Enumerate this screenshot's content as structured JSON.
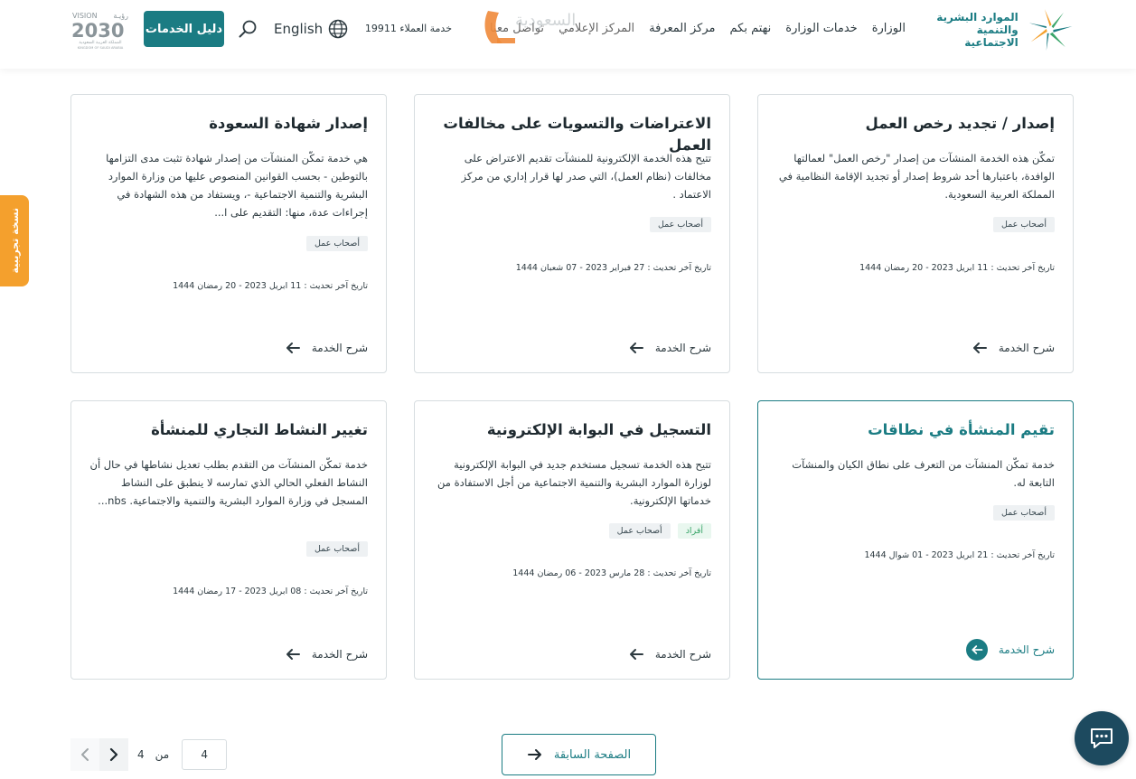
{
  "header": {
    "logo_line1": "الموارد البشرية",
    "logo_line2": "والتنمية الاجتماعية",
    "nav": [
      "الوزارة",
      "خدمات الوزارة",
      "نهتم بكم",
      "مركز المعرفة",
      "المركز الإعلامي",
      "تواصل معنا"
    ],
    "hotline": "خدمة العملاء 19911",
    "language": "English",
    "guide_button": "دليل الخدمات",
    "watermark_text": "السعودية",
    "vision_text": "VISION",
    "vision_year": "2030",
    "vision_ar": "رؤيـة",
    "vision_sub": "المملكة العربية السعودية",
    "vision_sub_en": "KINGDOM OF SAUDI ARABIA",
    "colors": {
      "primary": "#1b7c83",
      "accent": "#f4a02d",
      "chat": "#1d4a5f"
    }
  },
  "side_tab": "نسخة تجريبية",
  "cards": [
    {
      "title": "إصدار / تجديد رخص العمل",
      "description": "تمكّن هذه الخدمة المنشآت من إصدار \"رخص العمل\" لعمالتها الوافدة، باعتبارها أحد شروط إصدار أو تجديد الإقامة النظامية في المملكة العربية السعودية.",
      "tags": [
        {
          "label": "أصحاب عمل",
          "style": "gray"
        }
      ],
      "date": "تاريخ آخر تحديث : 11 ابريل 2023 - 20 رمضان 1444",
      "link": "شرح الخدمة"
    },
    {
      "title": "الاعتراضات والتسويات على مخالفات العمل",
      "description": "تتيح هذه الخدمة الإلكترونية للمنشآت تقديم الاعتراض على مخالفات (نظام العمل)، التي صدر لها قرار إداري من مركز الاعتماد .",
      "tags": [
        {
          "label": "أصحاب عمل",
          "style": "gray"
        }
      ],
      "date": "تاريخ آخر تحديث : 27 فبراير 2023 - 07 شعبان 1444",
      "link": "شرح الخدمة"
    },
    {
      "title": "إصدار شهادة السعودة",
      "description": "هي خدمة تمكّن المنشآت من إصدار شهادة تثبت مدى التزامها بالتوطين - بحسب القوانين المنصوص عليها من وزارة الموارد البشرية والتنمية الاجتماعية -، ويستفاد من هذه الشهادة في إجراءات عدة، منها: التقديم على ا...",
      "tags": [
        {
          "label": "أصحاب عمل",
          "style": "gray"
        }
      ],
      "date": "تاريخ آخر تحديث : 11 ابريل 2023 - 20 رمضان 1444",
      "link": "شرح الخدمة"
    },
    {
      "title": "تقيم المنشأة في نطاقات",
      "description": "خدمة تمكّن المنشآت من التعرف على نطاق الكيان والمنشآت التابعة له.",
      "tags": [
        {
          "label": "أصحاب عمل",
          "style": "gray"
        }
      ],
      "date": "تاريخ آخر تحديث : 21 ابريل 2023 - 01 شوال 1444",
      "link": "شرح الخدمة"
    },
    {
      "title": "التسجيل في البوابة الإلكترونية",
      "description": "تتيح هذه الخدمة تسجيل مستخدم جديد في البوابة الإلكترونية لوزارة الموارد البشرية والتنمية الاجتماعية من أجل الاستفادة من خدماتها الإلكترونية.",
      "tags": [
        {
          "label": "أفراد",
          "style": "green"
        },
        {
          "label": "أصحاب عمل",
          "style": "gray"
        }
      ],
      "date": "تاريخ آخر تحديث : 28 مارس 2023 - 06 رمضان 1444",
      "link": "شرح الخدمة"
    },
    {
      "title": "تغيير النشاط التجاري للمنشأة",
      "description": "خدمة تمكّن المنشآت من التقدم بطلب تعديل نشاطها في حال أن النشاط الفعلي الحالي الذي تمارسه لا ينطبق على النشاط المسجل في وزارة الموارد البشرية والتنمية والاجتماعية. nbs...",
      "tags": [
        {
          "label": "أصحاب عمل",
          "style": "gray"
        }
      ],
      "date": "تاريخ آخر تحديث : 08 ابريل 2023 - 17 رمضان 1444",
      "link": "شرح الخدمة"
    }
  ],
  "pagination": {
    "current": "4",
    "of_label": "من",
    "total": "4",
    "prev_page_label": "الصفحة السابقة"
  }
}
